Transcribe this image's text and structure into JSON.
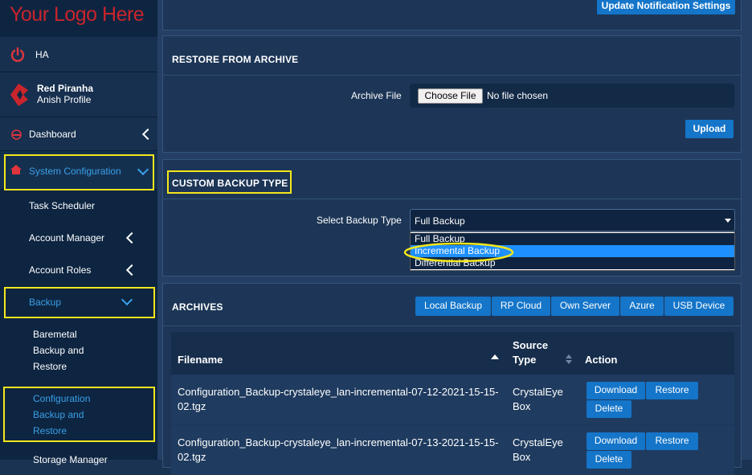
{
  "sidebar": {
    "logo": "Your Logo Here",
    "power_label": "HA",
    "profile_name": "Red Piranha",
    "profile_sub": "Anish Profile",
    "items": [
      {
        "label": "Dashboard"
      },
      {
        "label": "System Configuration"
      },
      {
        "label": "Task Scheduler"
      },
      {
        "label": "Account Manager"
      },
      {
        "label": "Account Roles"
      },
      {
        "label": "Backup"
      }
    ],
    "backup_sub": [
      {
        "line1": "Baremetal",
        "line2": "Backup and",
        "line3": "Restore"
      },
      {
        "line1": "Configuration",
        "line2": "Backup and",
        "line3": "Restore"
      }
    ],
    "cut_item": "Storage Manager"
  },
  "top": {
    "update_button": "Update Notification Settings"
  },
  "restore": {
    "title": "RESTORE FROM ARCHIVE",
    "archive_label": "Archive File",
    "choose_button": "Choose File",
    "no_file": "No file chosen",
    "upload_button": "Upload"
  },
  "custom": {
    "title": "CUSTOM BACKUP TYPE",
    "select_label": "Select Backup Type",
    "selected": "Full Backup",
    "options": [
      "Full Backup",
      "Incremental Backup",
      "Differential Backup"
    ]
  },
  "archives": {
    "title": "ARCHIVES",
    "tabs": [
      "Local Backup",
      "RP Cloud",
      "Own Server",
      "Azure",
      "USB Device"
    ],
    "columns": {
      "filename": "Filename",
      "source1": "Source",
      "source2": "Type",
      "action": "Action"
    },
    "rows": [
      {
        "file1": "Configuration_Backup-crystaleye_lan-incremental-07-12-2021-15-15-",
        "file2": "02.tgz",
        "src1": "CrystalEye",
        "src2": "Box",
        "download": "Download",
        "restore": "Restore",
        "delete": "Delete"
      },
      {
        "file1": "Configuration_Backup-crystaleye_lan-incremental-07-13-2021-15-15-",
        "file2": "02.tgz",
        "src1": "CrystalEye",
        "src2": "Box",
        "download": "Download",
        "restore": "Restore",
        "delete": "Delete"
      }
    ]
  },
  "colors": {
    "accent": "#1475c9",
    "highlight": "#f4e71b",
    "brand_red": "#c9252c",
    "link_blue": "#3aa0e8"
  }
}
